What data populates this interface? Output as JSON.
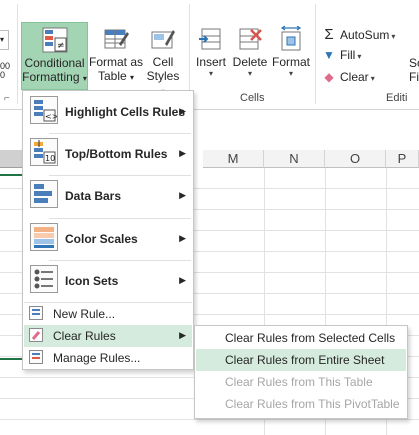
{
  "ribbon": {
    "left_clip_top": "00",
    "left_clip_bottom": "0",
    "conditional_formatting": {
      "line1": "Conditional",
      "line2": "Formatting"
    },
    "format_as_table": {
      "line1": "Format as",
      "line2": "Table"
    },
    "cell_styles": {
      "line1": "Cell",
      "line2": "Styles"
    },
    "insert": "Insert",
    "delete": "Delete",
    "format": "Format",
    "autosum": "AutoSum",
    "fill": "Fill",
    "clear": "Clear",
    "clip_right_1": "So",
    "clip_right_2": "Fi",
    "groups": {
      "cells": "Cells",
      "editing": "Editi"
    },
    "dialog_launcher": "⌐"
  },
  "columns": [
    "M",
    "N",
    "O",
    "P"
  ],
  "menu": {
    "items": [
      {
        "label": "Highlight Cells Rules",
        "icon": "highlight-cells-rules-icon"
      },
      {
        "label": "Top/Bottom Rules",
        "icon": "top-bottom-rules-icon",
        "icon_text": "10"
      },
      {
        "label": "Data Bars",
        "icon": "data-bars-icon"
      },
      {
        "label": "Color Scales",
        "icon": "color-scales-icon"
      },
      {
        "label": "Icon Sets",
        "icon": "icon-sets-icon"
      }
    ],
    "new_rule": "New Rule...",
    "clear_rules": "Clear Rules",
    "manage_rules": "Manage Rules..."
  },
  "submenu": {
    "items": [
      {
        "label": "Clear Rules from Selected Cells",
        "state": "enabled"
      },
      {
        "label": "Clear Rules from Entire Sheet",
        "state": "highlighted"
      },
      {
        "label": "Clear Rules from This Table",
        "state": "disabled"
      },
      {
        "label": "Clear Rules from This PivotTable",
        "state": "disabled"
      }
    ]
  },
  "colors": {
    "accent_green": "#217346",
    "highlight": "#d5ebdd",
    "active_button": "#a3d4b4"
  }
}
